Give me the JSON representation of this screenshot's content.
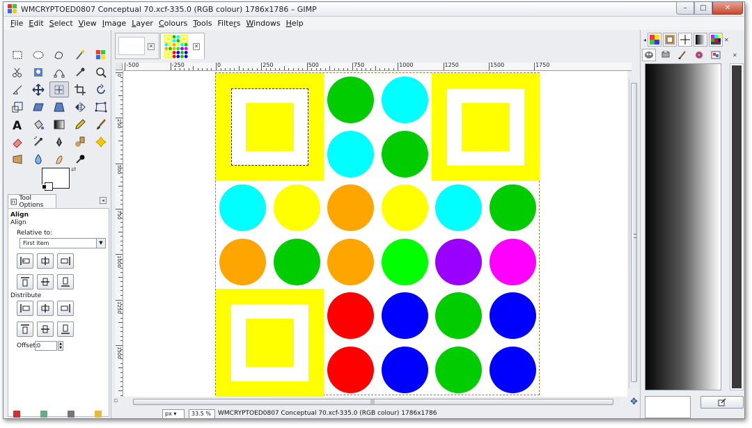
{
  "window": {
    "title": "WMCRYPTOED0807 Conceptual 70.xcf-335.0 (RGB colour) 1786x1786 – GIMP",
    "controls": {
      "minimize": "–",
      "maximize": "□",
      "close": "✕"
    }
  },
  "menubar": {
    "items": [
      {
        "label": "File",
        "underline": "F"
      },
      {
        "label": "Edit",
        "underline": "E"
      },
      {
        "label": "Select",
        "underline": "S"
      },
      {
        "label": "View",
        "underline": "V"
      },
      {
        "label": "Image",
        "underline": "I"
      },
      {
        "label": "Layer",
        "underline": "L"
      },
      {
        "label": "Colours",
        "underline": "C"
      },
      {
        "label": "Tools",
        "underline": "T"
      },
      {
        "label": "Filters",
        "underline": "r"
      },
      {
        "label": "Windows",
        "underline": "W"
      },
      {
        "label": "Help",
        "underline": "H"
      }
    ]
  },
  "toolbox": {
    "tools": [
      "rect-select",
      "ellipse-select",
      "free-select",
      "fuzzy-select",
      "select-by-color",
      "scissors-select",
      "foreground-select",
      "paths",
      "color-picker",
      "zoom",
      "measure",
      "move",
      "align",
      "crop",
      "rotate",
      "scale",
      "shear",
      "perspective",
      "flip",
      "cage-transform",
      "text",
      "bucket-fill",
      "blend",
      "pencil",
      "paintbrush",
      "eraser",
      "airbrush",
      "ink",
      "clone",
      "heal",
      "perspective-clone",
      "blur",
      "smudge",
      "dodge-burn"
    ],
    "active_tool_index": 12,
    "fg_color": "#ffffff",
    "bg_color": "#ffffff"
  },
  "tool_options": {
    "tab_label": "Tool Options",
    "heading": "Align",
    "subheading": "Align",
    "relative_label": "Relative to:",
    "relative_value": "First item",
    "distribute_label": "Distribute",
    "offset_label": "Offset:",
    "offset_value": "0"
  },
  "hruler": {
    "labels": [
      "-500",
      "-250",
      "0",
      "250",
      "500",
      "750",
      "1000",
      "1250",
      "1500",
      "1750"
    ]
  },
  "vruler": {
    "labels": [
      "0",
      "250",
      "500",
      "750",
      "1000",
      "1250",
      "1500"
    ]
  },
  "statusbar": {
    "unit": "px",
    "zoom": "33.5 %",
    "text": "WMCRYPTOED0807 Conceptual 70.xcf-335.0 (RGB colour) 1786x1786"
  },
  "artwork": {
    "colors": {
      "yellow": "#ffff00",
      "green": "#00cc00",
      "cyan": "#00ffff",
      "orange": "#ffa500",
      "lime": "#00ff00",
      "purple": "#9900ff",
      "magenta": "#ff00ff",
      "red": "#ff0000",
      "blue": "#0000ff"
    },
    "squares": [
      {
        "col": 0,
        "row": 0
      },
      {
        "col": 4,
        "row": 0
      },
      {
        "col": 0,
        "row": 4
      }
    ],
    "circles": [
      {
        "col": 2,
        "row": 0,
        "color": "green"
      },
      {
        "col": 3,
        "row": 0,
        "color": "cyan"
      },
      {
        "col": 2,
        "row": 1,
        "color": "cyan"
      },
      {
        "col": 3,
        "row": 1,
        "color": "green"
      },
      {
        "col": 0,
        "row": 2,
        "color": "cyan"
      },
      {
        "col": 1,
        "row": 2,
        "color": "yellow"
      },
      {
        "col": 2,
        "row": 2,
        "color": "orange"
      },
      {
        "col": 3,
        "row": 2,
        "color": "yellow"
      },
      {
        "col": 4,
        "row": 2,
        "color": "cyan"
      },
      {
        "col": 5,
        "row": 2,
        "color": "green"
      },
      {
        "col": 0,
        "row": 3,
        "color": "orange"
      },
      {
        "col": 1,
        "row": 3,
        "color": "green"
      },
      {
        "col": 2,
        "row": 3,
        "color": "orange"
      },
      {
        "col": 3,
        "row": 3,
        "color": "lime"
      },
      {
        "col": 4,
        "row": 3,
        "color": "purple"
      },
      {
        "col": 5,
        "row": 3,
        "color": "magenta"
      },
      {
        "col": 2,
        "row": 4,
        "color": "red"
      },
      {
        "col": 3,
        "row": 4,
        "color": "blue"
      },
      {
        "col": 4,
        "row": 4,
        "color": "green"
      },
      {
        "col": 5,
        "row": 4,
        "color": "blue"
      },
      {
        "col": 2,
        "row": 5,
        "color": "red"
      },
      {
        "col": 3,
        "row": 5,
        "color": "blue"
      },
      {
        "col": 4,
        "row": 5,
        "color": "green"
      },
      {
        "col": 5,
        "row": 5,
        "color": "blue"
      }
    ]
  }
}
